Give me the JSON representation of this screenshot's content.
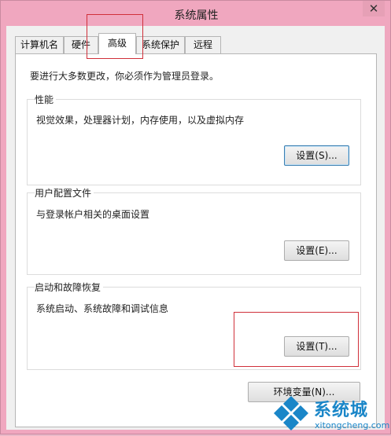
{
  "window": {
    "title": "系统属性",
    "close_glyph": "✕"
  },
  "tabs": [
    {
      "label": "计算机名"
    },
    {
      "label": "硬件"
    },
    {
      "label": "高级",
      "selected": true
    },
    {
      "label": "系统保护"
    },
    {
      "label": "远程"
    }
  ],
  "notice": "要进行大多数更改，你必须作为管理员登录。",
  "performance": {
    "label": "性能",
    "desc": "视觉效果，处理器计划，内存使用，以及虚拟内存",
    "button": "设置(S)..."
  },
  "profiles": {
    "label": "用户配置文件",
    "desc": "与登录帐户相关的桌面设置",
    "button": "设置(E)..."
  },
  "startup": {
    "label": "启动和故障恢复",
    "desc": "系统启动、系统故障和调试信息",
    "button": "设置(T)..."
  },
  "env_button": "环境变量(N)...",
  "watermark": {
    "name": "系统城",
    "url": "xitongcheng.com"
  },
  "colors": {
    "frame": "#f0a7bf",
    "highlight": "#d0303a",
    "watermark": "#1a86c8"
  }
}
